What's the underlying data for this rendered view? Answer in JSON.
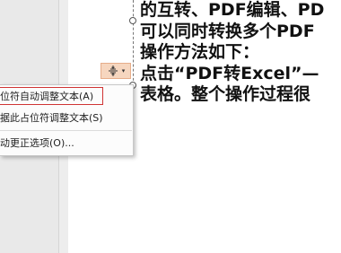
{
  "slide": {
    "lines": [
      "的互转、PDF编辑、PD",
      "可以同时转换多个PDF",
      "操作方法如下：",
      "点击“PDF转Excel”—",
      "表格。整个操作过程很"
    ]
  },
  "autofit_button": {
    "icon": "autofit-options-icon",
    "arrow": "▾"
  },
  "autofit_menu": {
    "items": [
      {
        "label": "位符自动调整文本(A)"
      },
      {
        "label": "据此占位符调整文本(S)"
      },
      {
        "label": "动更正选项(O)..."
      }
    ]
  },
  "colors": {
    "highlight_border": "#d03434",
    "autofit_button_bg": "#f6d6bf"
  }
}
